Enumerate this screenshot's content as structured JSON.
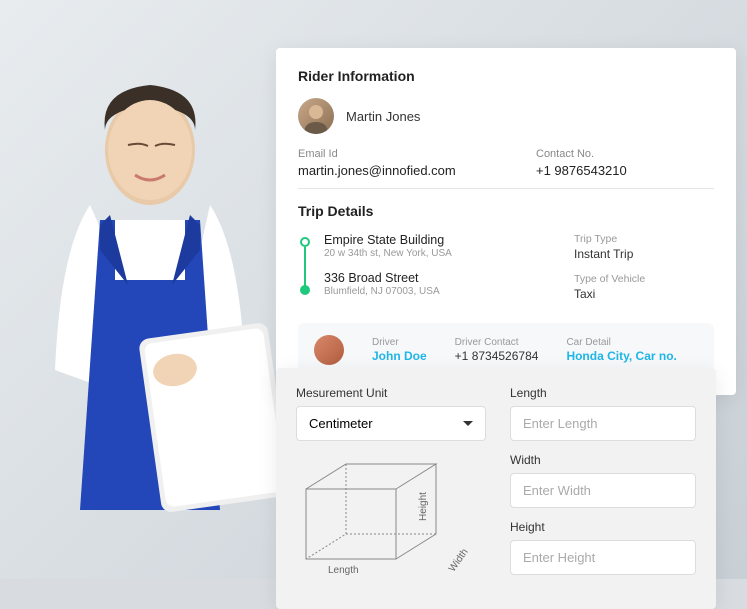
{
  "rider": {
    "title": "Rider Information",
    "name": "Martin Jones",
    "emailLabel": "Email Id",
    "email": "martin.jones@innofied.com",
    "contactLabel": "Contact No.",
    "contact": "+1 9876543210"
  },
  "trip": {
    "title": "Trip Details",
    "start": {
      "name": "Empire State Building",
      "addr": "20 w 34th st, New York, USA"
    },
    "end": {
      "name": "336 Broad Street",
      "addr": "Blumfield, NJ 07003, USA"
    },
    "typeLabel": "Trip Type",
    "type": "Instant Trip",
    "vehicleLabel": "Type of Vehicle",
    "vehicle": "Taxi"
  },
  "driver": {
    "label": "Driver",
    "name": "John Doe",
    "contactLabel": "Driver Contact",
    "contact": "+1 8734526784",
    "carLabel": "Car Detail",
    "car": "Honda City, Car no."
  },
  "measure": {
    "unitLabel": "Mesurement Unit",
    "unit": "Centimeter",
    "lengthLabel": "Length",
    "lengthPlaceholder": "Enter Length",
    "widthLabel": "Width",
    "widthPlaceholder": "Enter Width",
    "heightLabel": "Height",
    "heightPlaceholder": "Enter Height",
    "dimLength": "Length",
    "dimWidth": "Width",
    "dimHeight": "Height"
  }
}
